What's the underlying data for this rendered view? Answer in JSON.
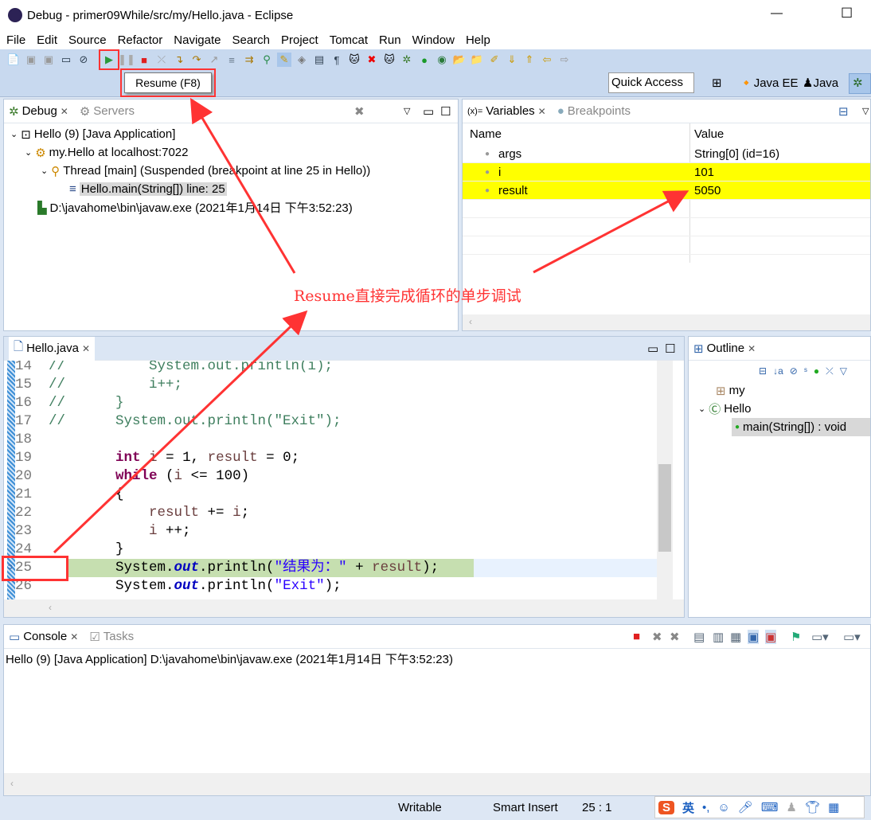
{
  "window": {
    "title": "Debug - primer09While/src/my/Hello.java - Eclipse",
    "minimize": "—",
    "maximize": "☐"
  },
  "menu": [
    "File",
    "Edit",
    "Source",
    "Refactor",
    "Navigate",
    "Search",
    "Project",
    "Tomcat",
    "Run",
    "Window",
    "Help"
  ],
  "tooltip": "Resume (F8)",
  "quick_access": "Quick Access",
  "perspectives": [
    "Java EE",
    "Java"
  ],
  "debug": {
    "tabs": [
      "Debug",
      "Servers"
    ],
    "tree": [
      "Hello (9) [Java Application]",
      "my.Hello at localhost:7022",
      "Thread [main] (Suspended (breakpoint at line 25 in Hello))",
      "Hello.main(String[]) line: 25",
      "D:\\javahome\\bin\\javaw.exe (2021年1月14日 下午3:52:23)"
    ]
  },
  "variables": {
    "tabs": [
      "Variables",
      "Breakpoints"
    ],
    "columns": [
      "Name",
      "Value"
    ],
    "rows": [
      {
        "name": "args",
        "value": "String[0]  (id=16)",
        "highlight": false
      },
      {
        "name": "i",
        "value": "101",
        "highlight": true
      },
      {
        "name": "result",
        "value": "5050",
        "highlight": true
      }
    ],
    "highlight_color": "#ffff00"
  },
  "annotation": "Resume直接完成循环的单步调试",
  "editor": {
    "tab": "Hello.java",
    "current_line": 25,
    "lines": [
      {
        "n": "14",
        "code": "//          System.out.println(i);"
      },
      {
        "n": "15",
        "code": "//          i++;"
      },
      {
        "n": "16",
        "code": "//      }"
      },
      {
        "n": "17",
        "code": "//      System.out.println(\"Exit\");"
      },
      {
        "n": "18",
        "code": ""
      },
      {
        "n": "19",
        "code": "        int i = 1, result = 0;"
      },
      {
        "n": "20",
        "code": "        while (i <= 100)"
      },
      {
        "n": "21",
        "code": "        {"
      },
      {
        "n": "22",
        "code": "            result += i;"
      },
      {
        "n": "23",
        "code": "            i ++;"
      },
      {
        "n": "24",
        "code": "        }"
      },
      {
        "n": "25",
        "code": "        System.out.println(\"结果为：\" + result);"
      },
      {
        "n": "26",
        "code": "        System.out.println(\"Exit\");"
      }
    ]
  },
  "outline": {
    "tab": "Outline",
    "items": [
      "my",
      "Hello",
      "main(String[]) : void"
    ]
  },
  "console": {
    "tabs": [
      "Console",
      "Tasks"
    ],
    "text": "Hello (9) [Java Application] D:\\javahome\\bin\\javaw.exe (2021年1月14日 下午3:52:23)"
  },
  "status": {
    "writable": "Writable",
    "insert": "Smart Insert",
    "position": "25 : 1",
    "ime": "英"
  },
  "accent_color": "#ff3333"
}
